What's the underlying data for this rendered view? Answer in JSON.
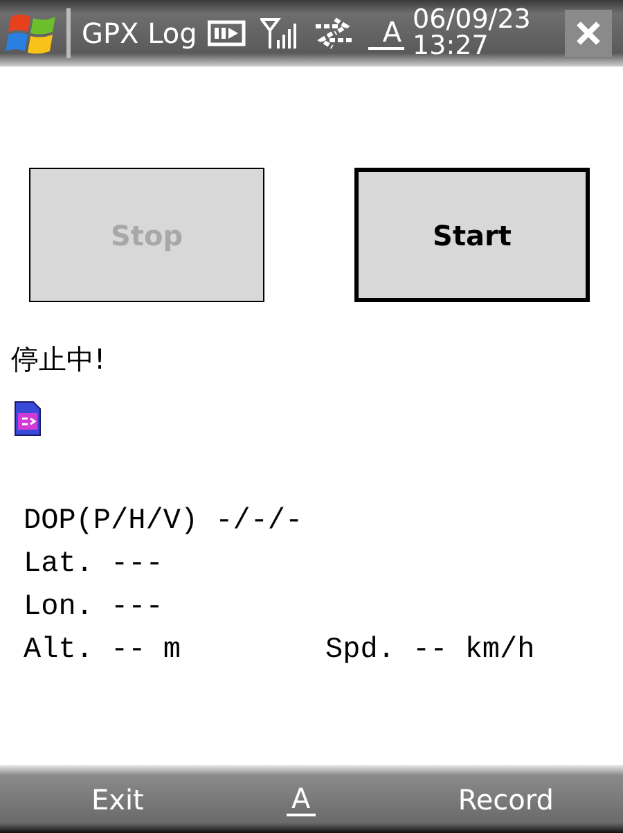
{
  "title_bar": {
    "title": "GPX Log",
    "date": "06/09/23",
    "time": "13:27",
    "input_indicator": "A"
  },
  "buttons": [
    {
      "label": "Stop",
      "disabled": true,
      "focused": false
    },
    {
      "label": "Start",
      "disabled": false,
      "focused": true
    }
  ],
  "status": "停止中!",
  "info_lines": [
    {
      "text": "DOP(P/H/V) -/-/-"
    },
    {
      "text": "Lat. ---"
    },
    {
      "text": "Lon. ---"
    },
    {
      "text": "Alt. -- m",
      "extra": "Spd. -- km/h"
    }
  ],
  "soft_keys": {
    "left": "Exit",
    "center": "A",
    "right": "Record"
  }
}
